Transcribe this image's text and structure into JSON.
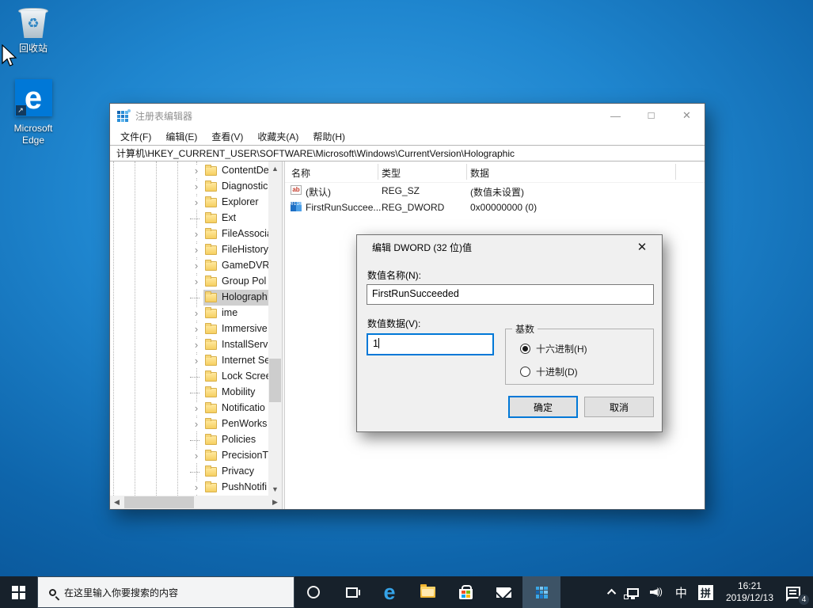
{
  "colors": {
    "accent": "#0078d7",
    "taskbar": "#17212b",
    "selection": "#cfcfcf",
    "folder": "#f6cf61"
  },
  "desktop": {
    "recycle_bin_label": "回收站",
    "edge_label_line1": "Microsoft",
    "edge_label_line2": "Edge"
  },
  "regedit": {
    "title": "注册表编辑器",
    "caption": {
      "minimize": "—",
      "maximize": "☐",
      "close": "✕"
    },
    "menu": [
      "文件(F)",
      "编辑(E)",
      "查看(V)",
      "收藏夹(A)",
      "帮助(H)"
    ],
    "address": "计算机\\HKEY_CURRENT_USER\\SOFTWARE\\Microsoft\\Windows\\CurrentVersion\\Holographic",
    "tree": [
      {
        "label": "ContentDe",
        "expandable": true,
        "selected": false
      },
      {
        "label": "Diagnostic",
        "expandable": true,
        "selected": false
      },
      {
        "label": "Explorer",
        "expandable": true,
        "selected": false
      },
      {
        "label": "Ext",
        "expandable": false,
        "selected": false
      },
      {
        "label": "FileAssocia",
        "expandable": true,
        "selected": false
      },
      {
        "label": "FileHistory",
        "expandable": true,
        "selected": false
      },
      {
        "label": "GameDVR",
        "expandable": true,
        "selected": false
      },
      {
        "label": "Group Pol",
        "expandable": true,
        "selected": false
      },
      {
        "label": "Holograph",
        "expandable": false,
        "selected": true
      },
      {
        "label": "ime",
        "expandable": true,
        "selected": false
      },
      {
        "label": "Immersive",
        "expandable": true,
        "selected": false
      },
      {
        "label": "InstallServ",
        "expandable": true,
        "selected": false
      },
      {
        "label": "Internet Se",
        "expandable": true,
        "selected": false
      },
      {
        "label": "Lock Scree",
        "expandable": false,
        "selected": false
      },
      {
        "label": "Mobility",
        "expandable": false,
        "selected": false
      },
      {
        "label": "Notificatio",
        "expandable": true,
        "selected": false
      },
      {
        "label": "PenWorks",
        "expandable": true,
        "selected": false
      },
      {
        "label": "Policies",
        "expandable": false,
        "selected": false
      },
      {
        "label": "PrecisionT",
        "expandable": true,
        "selected": false
      },
      {
        "label": "Privacy",
        "expandable": false,
        "selected": false
      },
      {
        "label": "PushNotifi",
        "expandable": true,
        "selected": false
      }
    ],
    "list": {
      "columns": [
        "名称",
        "类型",
        "数据"
      ],
      "rows": [
        {
          "icon": "string",
          "name": "(默认)",
          "type": "REG_SZ",
          "data": "(数值未设置)"
        },
        {
          "icon": "dword",
          "name": "FirstRunSuccee...",
          "type": "REG_DWORD",
          "data": "0x00000000 (0)"
        }
      ]
    }
  },
  "dialog": {
    "title": "编辑 DWORD (32 位)值",
    "close": "✕",
    "name_label": "数值名称(N):",
    "name_value": "FirstRunSucceeded",
    "data_label": "数值数据(V):",
    "data_value": "1",
    "base_group_label": "基数",
    "radio_hex_label": "十六进制(H)",
    "radio_dec_label": "十进制(D)",
    "ok_label": "确定",
    "cancel_label": "取消"
  },
  "taskbar": {
    "search_placeholder": "在这里输入你要搜索的内容",
    "tray": {
      "ime_lang": "中",
      "ime_mode": "拼",
      "time": "16:21",
      "date": "2019/12/13",
      "badge_count": "4"
    }
  }
}
